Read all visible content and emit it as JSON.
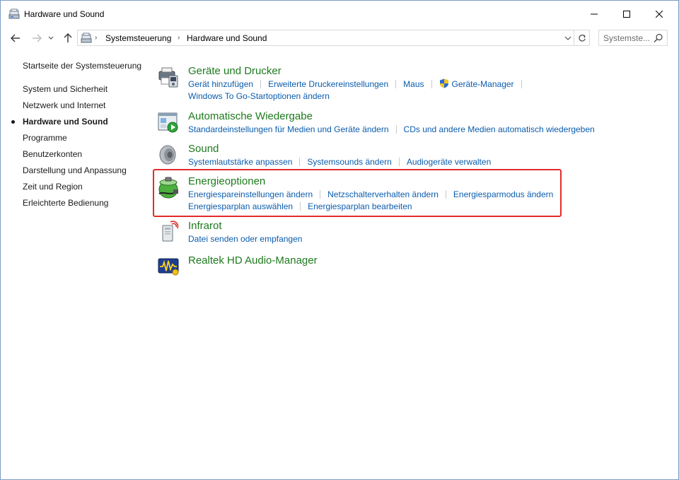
{
  "window": {
    "title": "Hardware und Sound",
    "controls": {
      "minimize": "minimize",
      "maximize": "maximize",
      "close": "close"
    }
  },
  "address": {
    "breadcrumbs": [
      "Systemsteuerung",
      "Hardware und Sound"
    ],
    "search_placeholder": "Systemste..."
  },
  "sidebar": {
    "items": [
      {
        "label": "Startseite der Systemsteuerung",
        "active": false
      },
      {
        "label": "System und Sicherheit",
        "active": false
      },
      {
        "label": "Netzwerk und Internet",
        "active": false
      },
      {
        "label": "Hardware und Sound",
        "active": true
      },
      {
        "label": "Programme",
        "active": false
      },
      {
        "label": "Benutzerkonten",
        "active": false
      },
      {
        "label": "Darstellung und Anpassung",
        "active": false
      },
      {
        "label": "Zeit und Region",
        "active": false
      },
      {
        "label": "Erleichterte Bedienung",
        "active": false
      }
    ]
  },
  "categories": [
    {
      "title": "Geräte und Drucker",
      "icon": "printer-device-icon",
      "links": [
        [
          "Gerät hinzufügen",
          "Erweiterte Druckereinstellungen",
          "Maus",
          "Geräte-Manager"
        ],
        [
          "Windows To Go-Startoptionen ändern"
        ]
      ]
    },
    {
      "title": "Automatische Wiedergabe",
      "icon": "autoplay-icon",
      "links": [
        [
          "Standardeinstellungen für Medien und Geräte ändern",
          "CDs und andere Medien automatisch wiedergeben"
        ]
      ]
    },
    {
      "title": "Sound",
      "icon": "speaker-icon",
      "links": [
        [
          "Systemlautstärke anpassen",
          "Systemsounds ändern",
          "Audiogeräte verwalten"
        ]
      ]
    },
    {
      "title": "Energieoptionen",
      "icon": "battery-power-icon",
      "links": [
        [
          "Energiespareinstellungen ändern",
          "Netzschalterverhalten ändern",
          "Energiesparmodus ändern"
        ],
        [
          "Energiesparplan auswählen",
          "Energiesparplan bearbeiten"
        ]
      ]
    },
    {
      "title": "Infrarot",
      "icon": "infrared-icon",
      "links": [
        [
          "Datei senden oder empfangen"
        ]
      ]
    },
    {
      "title": "Realtek HD Audio-Manager",
      "icon": "realtek-audio-icon",
      "links": []
    }
  ],
  "colors": {
    "category_title": "#1e7a1e",
    "link": "#0b5cad",
    "highlight_border": "#e32b2b"
  }
}
